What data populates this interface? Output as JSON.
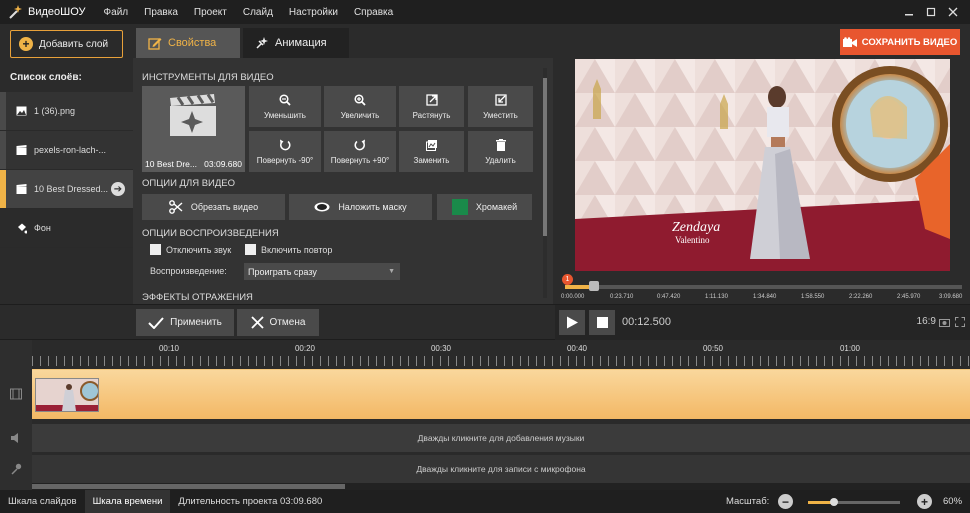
{
  "app": {
    "name": "ВидеоШОУ",
    "menu": [
      "Файл",
      "Правка",
      "Проект",
      "Слайд",
      "Настройки",
      "Справка"
    ]
  },
  "left_panel": {
    "add_layer_label": "Добавить слой",
    "layers_title": "Список слоёв:",
    "layers": [
      {
        "label": "1 (36).png",
        "icon": "image-icon"
      },
      {
        "label": "pexels-ron-lach-...",
        "icon": "clapper-icon"
      },
      {
        "label": "10 Best Dressed...",
        "icon": "clapper-icon",
        "selected": true
      },
      {
        "label": "Фон",
        "icon": "bucket-icon"
      }
    ]
  },
  "tabs": {
    "properties": "Свойства",
    "animation": "Анимация"
  },
  "video_tools": {
    "section_title": "ИНСТРУМЕНТЫ ДЛЯ ВИДЕО",
    "thumb_name": "10 Best Dre...",
    "thumb_duration": "03:09.680",
    "tools": [
      {
        "label": "Уменьшить",
        "icon": "zoom-out-icon"
      },
      {
        "label": "Увеличить",
        "icon": "zoom-in-icon"
      },
      {
        "label": "Растянуть",
        "icon": "stretch-icon"
      },
      {
        "label": "Уместить",
        "icon": "fit-icon"
      },
      {
        "label": "Повернуть -90°",
        "icon": "rotate-left-icon"
      },
      {
        "label": "Повернуть +90°",
        "icon": "rotate-right-icon"
      },
      {
        "label": "Заменить",
        "icon": "replace-icon"
      },
      {
        "label": "Удалить",
        "icon": "trash-icon"
      }
    ]
  },
  "video_options": {
    "section_title": "ОПЦИИ ДЛЯ ВИДЕО",
    "trim": "Обрезать видео",
    "mask": "Наложить маску",
    "chroma": "Хромакей",
    "chroma_color": "#1a8a4a"
  },
  "playback_options": {
    "section_title": "ОПЦИИ ВОСПРОИЗВЕДЕНИЯ",
    "mute": "Отключить звук",
    "loop": "Включить повтор",
    "playback_label": "Воспроизведение:",
    "playback_value": "Проиграть сразу"
  },
  "reflection": {
    "section_title": "ЭФФЕКТЫ ОТРАЖЕНИЯ"
  },
  "preview": {
    "save_label": "СОХРАНИТЬ ВИДЕО",
    "caption_name": "Zendaya",
    "caption_brand": "Valentino",
    "marker": "1",
    "progress": 0.02,
    "time_labels": [
      "0:00.000",
      "0:23.710",
      "0:47.420",
      "1:11.130",
      "1:34.840",
      "1:58.550",
      "2:22.260",
      "2:45.970",
      "3:09.680"
    ]
  },
  "apply_bar": {
    "apply": "Применить",
    "cancel": "Отмена",
    "timecode": "00:12.500",
    "ratio": "16:9"
  },
  "timeline": {
    "ruler": [
      "00:10",
      "00:20",
      "00:30",
      "00:40",
      "00:50",
      "01:00"
    ],
    "music_hint": "Дважды кликните для добавления музыки",
    "mic_hint": "Дважды кликните для записи с микрофона"
  },
  "status": {
    "slides_tab": "Шкала слайдов",
    "timeline_tab": "Шкала времени",
    "duration": "Длительность проекта 03:09.680",
    "zoom_label": "Масштаб:",
    "zoom_value": "60%",
    "zoom_fraction": 0.28
  },
  "colors": {
    "accent": "#f0b347",
    "save": "#e8562f"
  }
}
